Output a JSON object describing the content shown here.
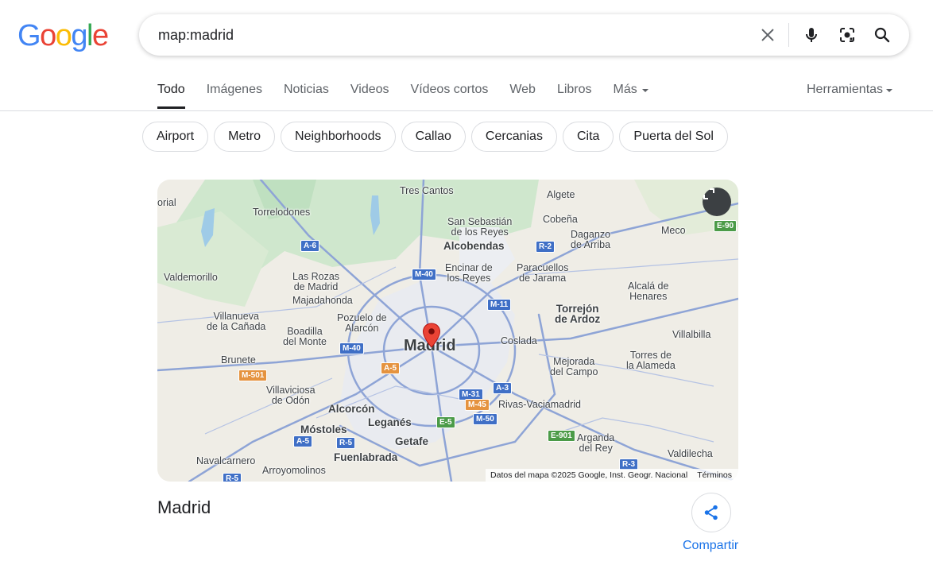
{
  "search": {
    "query": "map:madrid"
  },
  "logo": [
    "G",
    "o",
    "o",
    "g",
    "l",
    "e"
  ],
  "tabs": [
    {
      "label": "Todo"
    },
    {
      "label": "Imágenes"
    },
    {
      "label": "Noticias"
    },
    {
      "label": "Videos"
    },
    {
      "label": "Vídeos cortos"
    },
    {
      "label": "Web"
    },
    {
      "label": "Libros"
    },
    {
      "label": "Más"
    }
  ],
  "tools_label": "Herramientas",
  "chips": [
    "Airport",
    "Metro",
    "Neighborhoods",
    "Callao",
    "Cercanias",
    "Cita",
    "Puerta del Sol"
  ],
  "map": {
    "attribution": "Datos del mapa ©2025 Google, Inst. Geogr. Nacional",
    "terms": "Términos",
    "labels": {
      "tres_cantos": "Tres Cantos",
      "algete": "Algete",
      "torrelodones": "Torrelodones",
      "san_sebastian": "San Sebastián\nde los Reyes",
      "cobena": "Cobeña",
      "daganzo": "Daganzo\nde Arriba",
      "meco": "Meco",
      "alcobendas": "Alcobendas",
      "valdemorillo": "Valdemorillo",
      "las_rozas": "Las Rozas\nde Madrid",
      "encinar": "Encinar de\nlos Reyes",
      "paracuellos": "Paracuellos\nde Jarama",
      "alcala": "Alcalá de\nHenares",
      "majadahonda": "Majadahonda",
      "torrejon": "Torrejón\nde Ardoz",
      "villanueva": "Villanueva\nde la Cañada",
      "pozuelo": "Pozuelo de\nAlarcón",
      "boadilla": "Boadilla\ndel Monte",
      "madrid": "Madrid",
      "coslada": "Coslada",
      "villalbilla": "Villalbilla",
      "brunete": "Brunete",
      "mejorada": "Mejorada\ndel Campo",
      "torres": "Torres de\nla Alameda",
      "villaviciosa": "Villaviciosa\nde Odón",
      "alcorcon": "Alcorcón",
      "rivas": "Rivas-Vaciamadrid",
      "mostoles": "Móstoles",
      "leganes": "Leganés",
      "getafe": "Getafe",
      "arganda": "Arganda\ndel Rey",
      "fuenlabrada": "Fuenlabrada",
      "valdilecha": "Valdilecha",
      "navalcarnero": "Navalcarnero",
      "arroyomolinos": "Arroyomolinos",
      "orial": "orial"
    },
    "shields": {
      "a6": "A-6",
      "e90": "E-90",
      "r2": "R-2",
      "m40a": "M-40",
      "m11": "M-11",
      "m40b": "M-40",
      "m501": "M-501",
      "a5a": "A-5",
      "a3": "A-3",
      "m31": "M-31",
      "m45": "M-45",
      "e5": "E-5",
      "m50": "M-50",
      "e901": "E-901",
      "a5b": "A-5",
      "r5a": "R-5",
      "r3": "R-3",
      "r5b": "R-5"
    }
  },
  "place": {
    "title": "Madrid",
    "share_label": "Compartir"
  }
}
